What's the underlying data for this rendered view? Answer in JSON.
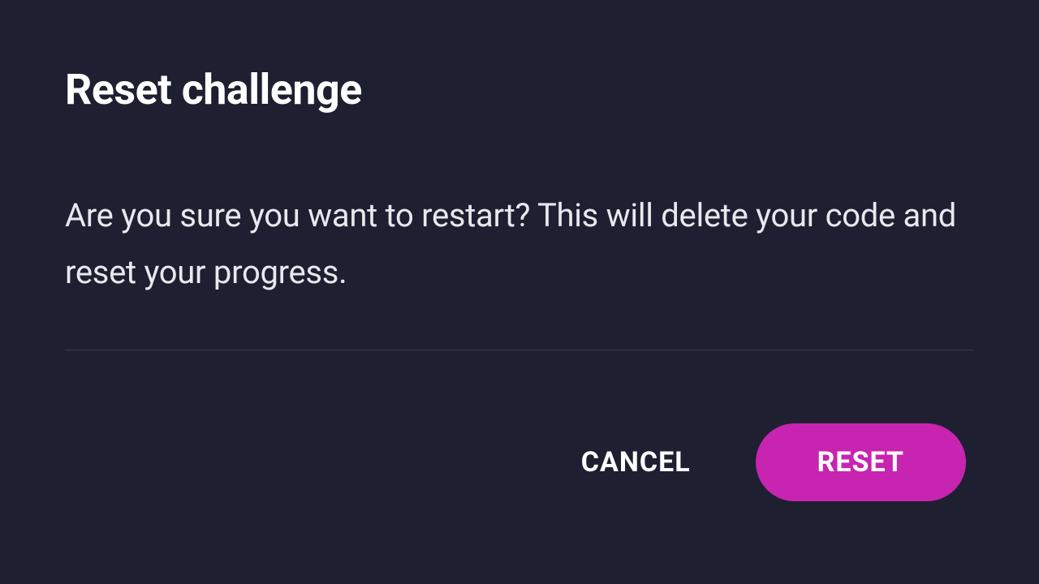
{
  "dialog": {
    "title": "Reset challenge",
    "message": "Are you sure you want to restart? This will delete your code and reset your progress.",
    "cancel_label": "CANCEL",
    "reset_label": "RESET"
  },
  "colors": {
    "background": "#1e1f30",
    "accent": "#c724b1",
    "text": "#ffffff",
    "divider": "#3a3b4d"
  }
}
